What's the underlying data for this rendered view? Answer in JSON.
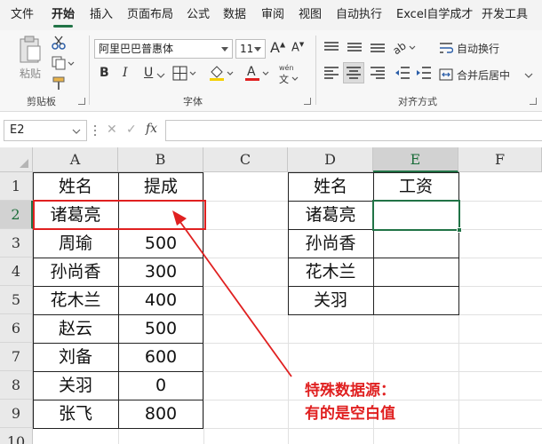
{
  "menubar": {
    "tabs": [
      "文件",
      "开始",
      "插入",
      "页面布局",
      "公式",
      "数据",
      "审阅",
      "视图",
      "自动执行",
      "Excel自学成才",
      "开发工具"
    ],
    "active_tab": "开始",
    "accent": "#217346"
  },
  "ribbon": {
    "clipboard": {
      "paste_label": "粘贴",
      "group_label": "剪贴板"
    },
    "font": {
      "font_name": "阿里巴巴普惠体",
      "font_size": "11",
      "bold": "B",
      "italic": "I",
      "underline": "U",
      "grow": "A",
      "shrink": "A",
      "wen": "wén",
      "group_label": "字体"
    },
    "alignment": {
      "wrap_text": "自动换行",
      "merge_center": "合并后居中",
      "group_label": "对齐方式"
    }
  },
  "formula_bar": {
    "name_box": "E2",
    "fx_label": "fx",
    "cancel": "✕",
    "confirm": "✓",
    "value": ""
  },
  "sheet": {
    "columns": [
      "A",
      "B",
      "C",
      "D",
      "E",
      "F"
    ],
    "selected_column": "E",
    "rows": [
      "1",
      "2",
      "3",
      "4",
      "5",
      "6",
      "7",
      "8",
      "9",
      "10"
    ],
    "selected_row": "2",
    "table1": {
      "headers": [
        "姓名",
        "提成"
      ],
      "rows": [
        [
          "诸葛亮",
          ""
        ],
        [
          "周瑜",
          "500"
        ],
        [
          "孙尚香",
          "300"
        ],
        [
          "花木兰",
          "400"
        ],
        [
          "赵云",
          "500"
        ],
        [
          "刘备",
          "600"
        ],
        [
          "关羽",
          "0"
        ],
        [
          "张飞",
          "800"
        ]
      ]
    },
    "table2": {
      "headers": [
        "姓名",
        "工资"
      ],
      "rows": [
        [
          "诸葛亮",
          ""
        ],
        [
          "孙尚香",
          ""
        ],
        [
          "花木兰",
          ""
        ],
        [
          "关羽",
          ""
        ]
      ]
    }
  },
  "annotation": {
    "line1": "特殊数据源：",
    "line2": "有的是空白值",
    "color": "#e02020"
  }
}
